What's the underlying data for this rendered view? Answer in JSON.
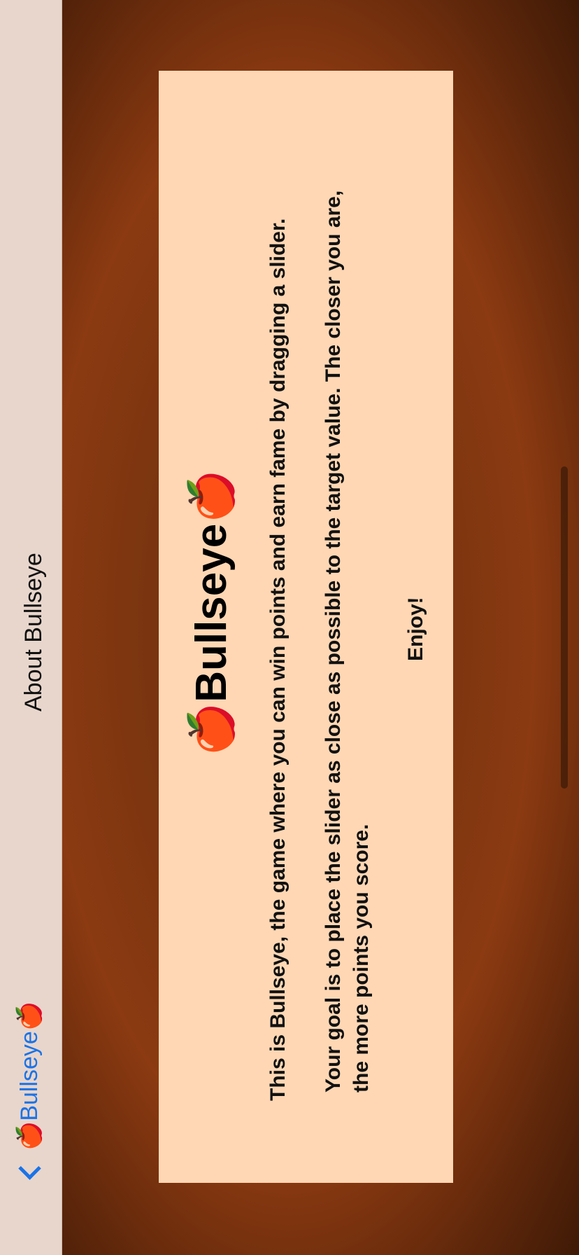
{
  "nav": {
    "title": "About Bullseye",
    "back_label": "🍎Bullseye🍎"
  },
  "card": {
    "heading": "🍎Bullseye🍎",
    "paragraph1": "This is Bullseye, the game where you can win points and earn fame by dragging a slider.",
    "paragraph2": "Your goal is to place the slider as close as possible to the target value. The closer you are, the more points you score.",
    "closing": "Enjoy!"
  },
  "colors": {
    "navbar_bg": "#e8d6cc",
    "card_bg": "#ffd7b4",
    "back_link": "#1a73e8",
    "background_wood": "#7a3510"
  }
}
